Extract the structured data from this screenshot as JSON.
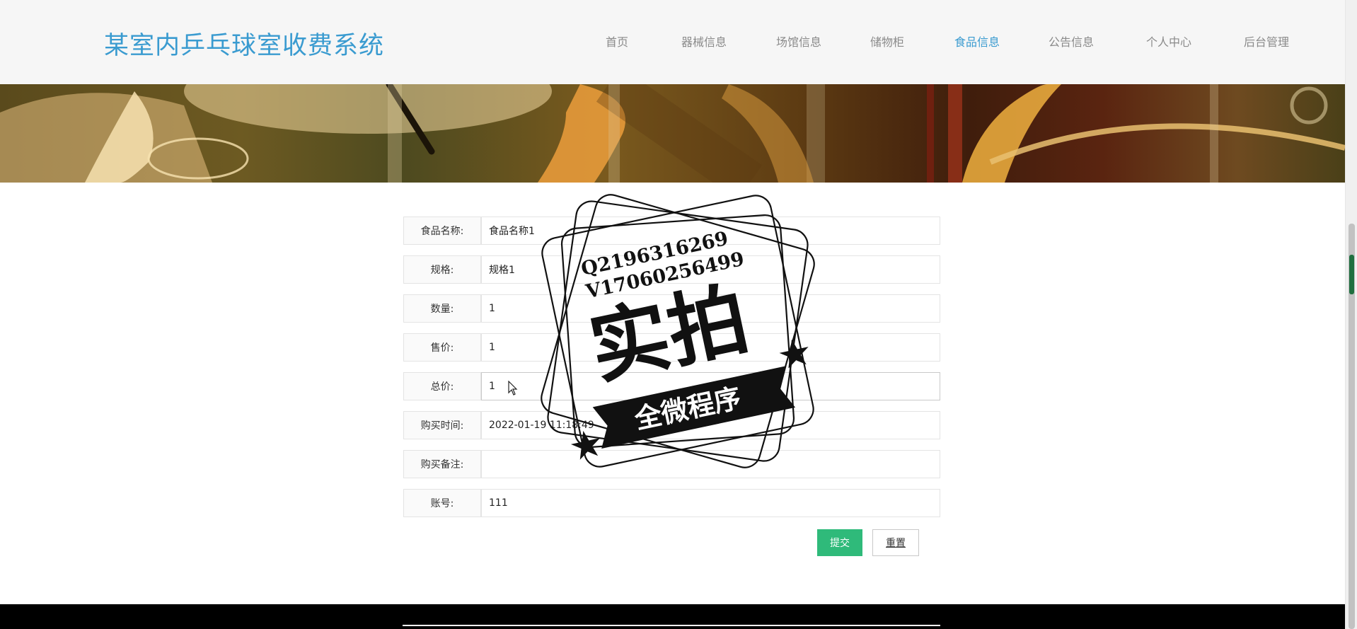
{
  "header": {
    "site_title": "某室内乒乓球室收费系统",
    "nav": [
      {
        "label": "首页",
        "active": false
      },
      {
        "label": "器械信息",
        "active": false
      },
      {
        "label": "场馆信息",
        "active": false
      },
      {
        "label": "储物柜",
        "active": false
      },
      {
        "label": "食品信息",
        "active": true
      },
      {
        "label": "公告信息",
        "active": false
      },
      {
        "label": "个人中心",
        "active": false
      },
      {
        "label": "后台管理",
        "active": false
      }
    ]
  },
  "form": {
    "fields": [
      {
        "label": "食品名称:",
        "value": "食品名称1"
      },
      {
        "label": "规格:",
        "value": "规格1"
      },
      {
        "label": "数量:",
        "value": "1"
      },
      {
        "label": "售价:",
        "value": "1"
      },
      {
        "label": "总价:",
        "value": "1"
      },
      {
        "label": "购买时间:",
        "value": "2022-01-19 11:18:49"
      },
      {
        "label": "购买备注:",
        "value": ""
      },
      {
        "label": "账号:",
        "value": "111"
      }
    ],
    "submit_label": "提交",
    "reset_label": "重置"
  },
  "watermark": {
    "line1": "Q2196316269",
    "line2": "V17060256499",
    "main": "实拍",
    "ribbon": "全微程序"
  },
  "colors": {
    "accent": "#3a9bd0",
    "submit": "#2fba7a",
    "nav_text": "#8a8a8a",
    "footer": "#000000"
  }
}
